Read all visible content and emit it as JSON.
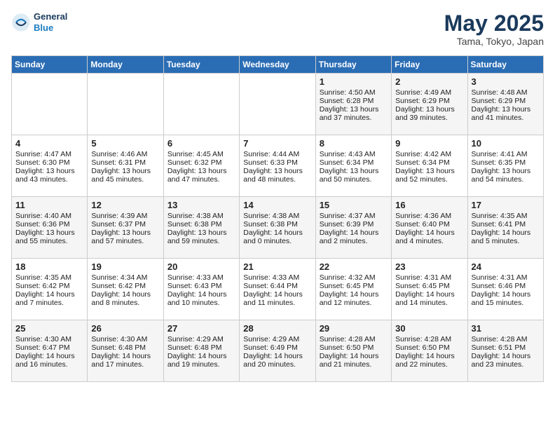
{
  "header": {
    "logo_general": "General",
    "logo_blue": "Blue",
    "title": "May 2025",
    "location": "Tama, Tokyo, Japan"
  },
  "weekdays": [
    "Sunday",
    "Monday",
    "Tuesday",
    "Wednesday",
    "Thursday",
    "Friday",
    "Saturday"
  ],
  "weeks": [
    [
      {
        "day": "",
        "info": ""
      },
      {
        "day": "",
        "info": ""
      },
      {
        "day": "",
        "info": ""
      },
      {
        "day": "",
        "info": ""
      },
      {
        "day": "1",
        "info": "Sunrise: 4:50 AM\nSunset: 6:28 PM\nDaylight: 13 hours\nand 37 minutes."
      },
      {
        "day": "2",
        "info": "Sunrise: 4:49 AM\nSunset: 6:29 PM\nDaylight: 13 hours\nand 39 minutes."
      },
      {
        "day": "3",
        "info": "Sunrise: 4:48 AM\nSunset: 6:29 PM\nDaylight: 13 hours\nand 41 minutes."
      }
    ],
    [
      {
        "day": "4",
        "info": "Sunrise: 4:47 AM\nSunset: 6:30 PM\nDaylight: 13 hours\nand 43 minutes."
      },
      {
        "day": "5",
        "info": "Sunrise: 4:46 AM\nSunset: 6:31 PM\nDaylight: 13 hours\nand 45 minutes."
      },
      {
        "day": "6",
        "info": "Sunrise: 4:45 AM\nSunset: 6:32 PM\nDaylight: 13 hours\nand 47 minutes."
      },
      {
        "day": "7",
        "info": "Sunrise: 4:44 AM\nSunset: 6:33 PM\nDaylight: 13 hours\nand 48 minutes."
      },
      {
        "day": "8",
        "info": "Sunrise: 4:43 AM\nSunset: 6:34 PM\nDaylight: 13 hours\nand 50 minutes."
      },
      {
        "day": "9",
        "info": "Sunrise: 4:42 AM\nSunset: 6:34 PM\nDaylight: 13 hours\nand 52 minutes."
      },
      {
        "day": "10",
        "info": "Sunrise: 4:41 AM\nSunset: 6:35 PM\nDaylight: 13 hours\nand 54 minutes."
      }
    ],
    [
      {
        "day": "11",
        "info": "Sunrise: 4:40 AM\nSunset: 6:36 PM\nDaylight: 13 hours\nand 55 minutes."
      },
      {
        "day": "12",
        "info": "Sunrise: 4:39 AM\nSunset: 6:37 PM\nDaylight: 13 hours\nand 57 minutes."
      },
      {
        "day": "13",
        "info": "Sunrise: 4:38 AM\nSunset: 6:38 PM\nDaylight: 13 hours\nand 59 minutes."
      },
      {
        "day": "14",
        "info": "Sunrise: 4:38 AM\nSunset: 6:38 PM\nDaylight: 14 hours\nand 0 minutes."
      },
      {
        "day": "15",
        "info": "Sunrise: 4:37 AM\nSunset: 6:39 PM\nDaylight: 14 hours\nand 2 minutes."
      },
      {
        "day": "16",
        "info": "Sunrise: 4:36 AM\nSunset: 6:40 PM\nDaylight: 14 hours\nand 4 minutes."
      },
      {
        "day": "17",
        "info": "Sunrise: 4:35 AM\nSunset: 6:41 PM\nDaylight: 14 hours\nand 5 minutes."
      }
    ],
    [
      {
        "day": "18",
        "info": "Sunrise: 4:35 AM\nSunset: 6:42 PM\nDaylight: 14 hours\nand 7 minutes."
      },
      {
        "day": "19",
        "info": "Sunrise: 4:34 AM\nSunset: 6:42 PM\nDaylight: 14 hours\nand 8 minutes."
      },
      {
        "day": "20",
        "info": "Sunrise: 4:33 AM\nSunset: 6:43 PM\nDaylight: 14 hours\nand 10 minutes."
      },
      {
        "day": "21",
        "info": "Sunrise: 4:33 AM\nSunset: 6:44 PM\nDaylight: 14 hours\nand 11 minutes."
      },
      {
        "day": "22",
        "info": "Sunrise: 4:32 AM\nSunset: 6:45 PM\nDaylight: 14 hours\nand 12 minutes."
      },
      {
        "day": "23",
        "info": "Sunrise: 4:31 AM\nSunset: 6:45 PM\nDaylight: 14 hours\nand 14 minutes."
      },
      {
        "day": "24",
        "info": "Sunrise: 4:31 AM\nSunset: 6:46 PM\nDaylight: 14 hours\nand 15 minutes."
      }
    ],
    [
      {
        "day": "25",
        "info": "Sunrise: 4:30 AM\nSunset: 6:47 PM\nDaylight: 14 hours\nand 16 minutes."
      },
      {
        "day": "26",
        "info": "Sunrise: 4:30 AM\nSunset: 6:48 PM\nDaylight: 14 hours\nand 17 minutes."
      },
      {
        "day": "27",
        "info": "Sunrise: 4:29 AM\nSunset: 6:48 PM\nDaylight: 14 hours\nand 19 minutes."
      },
      {
        "day": "28",
        "info": "Sunrise: 4:29 AM\nSunset: 6:49 PM\nDaylight: 14 hours\nand 20 minutes."
      },
      {
        "day": "29",
        "info": "Sunrise: 4:28 AM\nSunset: 6:50 PM\nDaylight: 14 hours\nand 21 minutes."
      },
      {
        "day": "30",
        "info": "Sunrise: 4:28 AM\nSunset: 6:50 PM\nDaylight: 14 hours\nand 22 minutes."
      },
      {
        "day": "31",
        "info": "Sunrise: 4:28 AM\nSunset: 6:51 PM\nDaylight: 14 hours\nand 23 minutes."
      }
    ]
  ]
}
